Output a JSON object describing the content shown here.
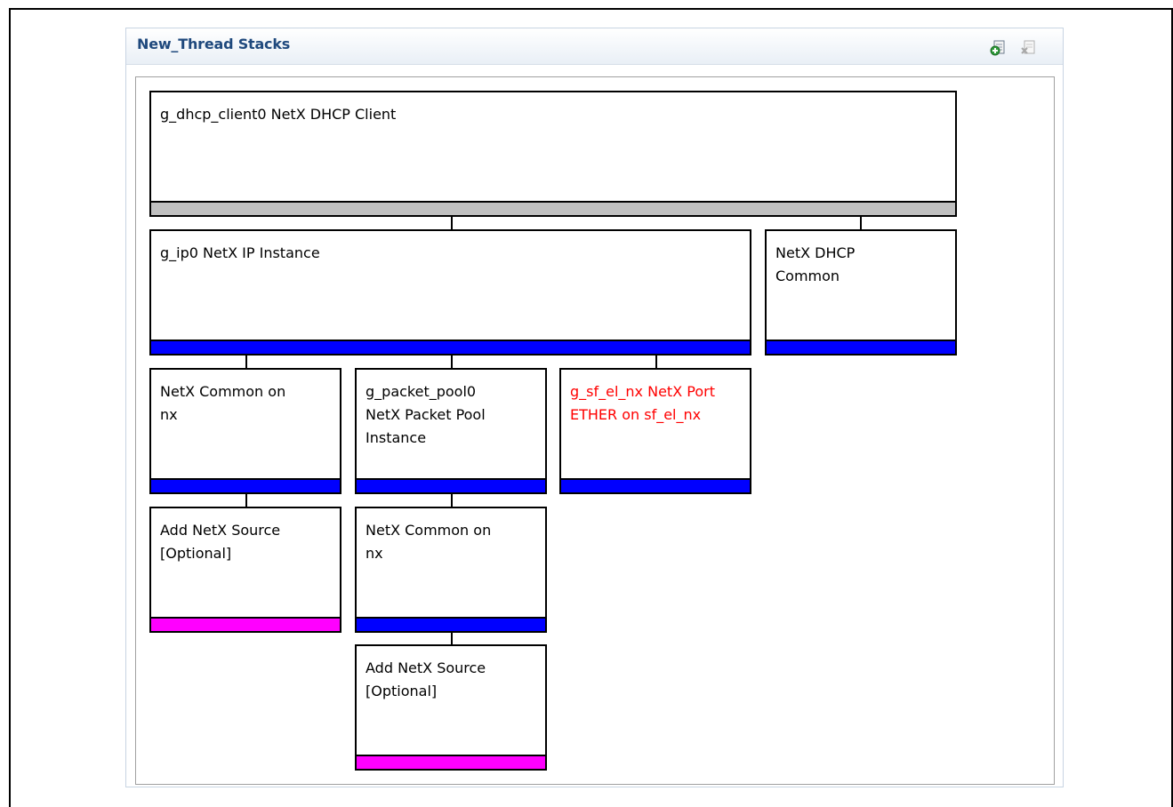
{
  "panel": {
    "title": "New_Thread Stacks",
    "icons": [
      "add-stack-icon",
      "remove-stack-icon"
    ]
  },
  "blocks": {
    "dhcp_client": {
      "label": "g_dhcp_client0 NetX DHCP Client",
      "status_color": "#c0c0c0"
    },
    "ip_instance": {
      "label": "g_ip0 NetX IP Instance",
      "status_color": "#0000ff"
    },
    "dhcp_common": {
      "label": "NetX DHCP\nCommon",
      "status_color": "#0000ff"
    },
    "netx_common_1": {
      "label": "NetX Common on\nnx",
      "status_color": "#0000ff"
    },
    "packet_pool": {
      "label": "g_packet_pool0\nNetX Packet Pool\nInstance",
      "status_color": "#0000ff"
    },
    "nx_port": {
      "label": "g_sf_el_nx NetX Port\nETHER on sf_el_nx",
      "status_color": "#0000ff",
      "text_color": "#ff0000"
    },
    "add_source_1": {
      "label": "Add NetX Source\n[Optional]",
      "status_color": "#ff00ff"
    },
    "netx_common_2": {
      "label": "NetX Common on\nnx",
      "status_color": "#0000ff"
    },
    "add_source_2": {
      "label": "Add NetX Source\n[Optional]",
      "status_color": "#ff00ff"
    }
  }
}
